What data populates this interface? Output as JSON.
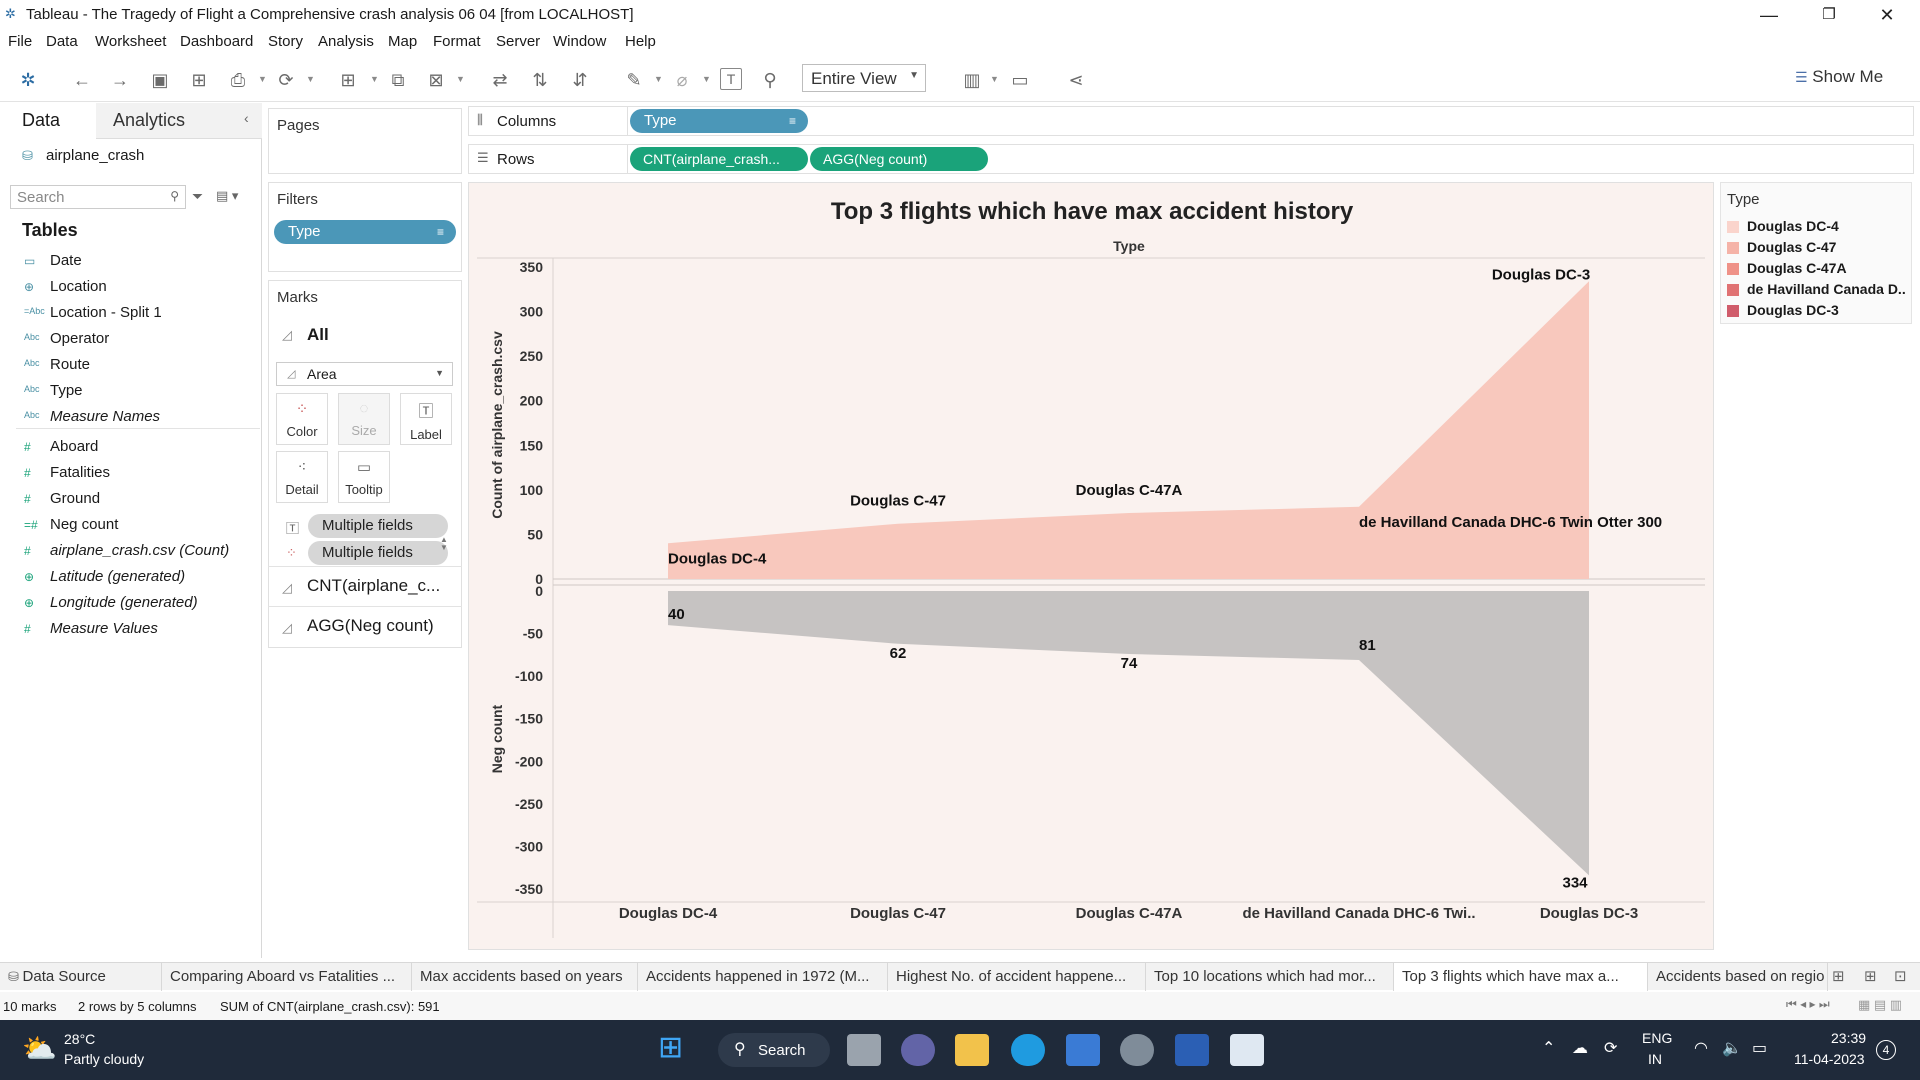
{
  "window": {
    "title": "Tableau - The Tragedy of Flight a Comprehensive crash analysis 06 04 [from LOCALHOST]",
    "minimize": "—",
    "restore": "❐",
    "close": "✕"
  },
  "menu": [
    "File",
    "Data",
    "Worksheet",
    "Dashboard",
    "Story",
    "Analysis",
    "Map",
    "Format",
    "Server",
    "Window",
    "Help"
  ],
  "toolbar": {
    "fit": "Entire View",
    "show_me": "Show Me"
  },
  "data_pane": {
    "tabs": [
      "Data",
      "Analytics"
    ],
    "datasource": "airplane_crash",
    "search_placeholder": "Search",
    "tables_heading": "Tables",
    "fields": [
      {
        "icon": "calendar-icon",
        "glyph": "▭",
        "name": "Date",
        "italic": false
      },
      {
        "icon": "globe-icon",
        "glyph": "⊕",
        "name": "Location",
        "italic": false
      },
      {
        "icon": "string-icon",
        "glyph": "=Abc",
        "name": "Location - Split 1",
        "italic": false
      },
      {
        "icon": "string-icon",
        "glyph": "Abc",
        "name": "Operator",
        "italic": false
      },
      {
        "icon": "string-icon",
        "glyph": "Abc",
        "name": "Route",
        "italic": false
      },
      {
        "icon": "string-icon",
        "glyph": "Abc",
        "name": "Type",
        "italic": false
      },
      {
        "icon": "string-icon",
        "glyph": "Abc",
        "name": "Measure Names",
        "italic": true
      },
      {
        "icon": "number-icon",
        "glyph": "#",
        "name": "Aboard",
        "italic": false
      },
      {
        "icon": "number-icon",
        "glyph": "#",
        "name": "Fatalities",
        "italic": false
      },
      {
        "icon": "number-icon",
        "glyph": "#",
        "name": "Ground",
        "italic": false
      },
      {
        "icon": "calc-number-icon",
        "glyph": "=#",
        "name": "Neg count",
        "italic": false
      },
      {
        "icon": "number-icon",
        "glyph": "#",
        "name": "airplane_crash.csv (Count)",
        "italic": true
      },
      {
        "icon": "globe-icon",
        "glyph": "⊕",
        "name": "Latitude (generated)",
        "italic": true
      },
      {
        "icon": "globe-icon",
        "glyph": "⊕",
        "name": "Longitude (generated)",
        "italic": true
      },
      {
        "icon": "number-icon",
        "glyph": "#",
        "name": "Measure Values",
        "italic": true
      }
    ]
  },
  "pages": {
    "title": "Pages"
  },
  "filters": {
    "title": "Filters",
    "pill": "Type"
  },
  "marks": {
    "title": "Marks",
    "all": "All",
    "type": "Area",
    "buttons": [
      "Color",
      "Size",
      "Label",
      "Detail",
      "Tooltip"
    ],
    "pills": [
      "Multiple fields",
      "Multiple fields"
    ],
    "measures": [
      "CNT(airplane_c...",
      "AGG(Neg count)"
    ]
  },
  "shelves": {
    "columns_label": "Columns",
    "rows_label": "Rows",
    "columns_pill": "Type",
    "rows_pills": [
      "CNT(airplane_crash...",
      "AGG(Neg count)"
    ]
  },
  "chart_data": {
    "type": "area",
    "title": "Top 3 flights which have max accident history",
    "column_header": "Type",
    "categories": [
      "Douglas DC-4",
      "Douglas C-47",
      "Douglas C-47A",
      "de Havilland Canada DHC-6 Twin Otter 300",
      "Douglas DC-3"
    ],
    "category_axis_labels": [
      "Douglas DC-4",
      "Douglas C-47",
      "Douglas C-47A",
      "de Havilland Canada DHC-6 Twi..",
      "Douglas DC-3"
    ],
    "series": [
      {
        "name": "CNT(airplane_crash.csv)",
        "values": [
          40,
          62,
          74,
          81,
          334
        ],
        "color": "#f8c8bd"
      },
      {
        "name": "AGG(Neg count)",
        "values": [
          -40,
          -62,
          -74,
          -81,
          -334
        ],
        "color": "#c6c3c2"
      }
    ],
    "top_axis": {
      "label": "Count of airplane_crash.csv",
      "ticks": [
        0,
        50,
        100,
        150,
        200,
        250,
        300,
        350
      ],
      "ylim": [
        0,
        350
      ]
    },
    "bottom_axis": {
      "label": "Neg count",
      "ticks": [
        0,
        -50,
        -100,
        -150,
        -200,
        -250,
        -300,
        -350
      ],
      "ylim": [
        -350,
        0
      ]
    },
    "top_labels": [
      "Douglas DC-4",
      "Douglas C-47",
      "Douglas C-47A",
      "de Havilland Canada DHC-6 Twin Otter 300",
      "Douglas DC-3"
    ],
    "bottom_labels": [
      "40",
      "62",
      "74",
      "81",
      "334"
    ]
  },
  "legend": {
    "title": "Type",
    "items": [
      {
        "label": "Douglas DC-4",
        "color": "#fad4cc"
      },
      {
        "label": "Douglas C-47",
        "color": "#f5b3a8"
      },
      {
        "label": "Douglas C-47A",
        "color": "#ef9288"
      },
      {
        "label": "de Havilland Canada D..",
        "color": "#e07273"
      },
      {
        "label": "Douglas DC-3",
        "color": "#d05c6b"
      }
    ]
  },
  "sheet_tabs": [
    "Data Source",
    "Comparing Aboard vs Fatalities ...",
    "Max accidents based on years",
    "Accidents happened in 1972 (M...",
    "Highest No. of accident happene...",
    "Top 10 locations which had mor...",
    "Top 3 flights which have max a...",
    "Accidents based on regio"
  ],
  "status": {
    "marks": "10 marks",
    "dims": "2 rows by 5 columns",
    "sum": "SUM of CNT(airplane_crash.csv): 591"
  },
  "taskbar": {
    "weather_temp": "28°C",
    "weather_desc": "Partly cloudy",
    "search": "Search",
    "lang1": "ENG",
    "lang2": "IN",
    "time": "23:39",
    "date": "11-04-2023",
    "notif": "4"
  }
}
